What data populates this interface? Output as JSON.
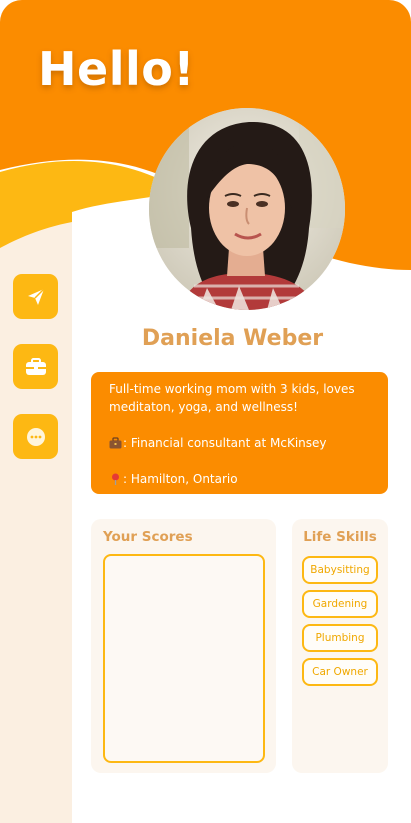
{
  "header": {
    "greeting": "Hello!"
  },
  "colors": {
    "primary": "#fb8c00",
    "accent": "#fdb813",
    "name": "#e0a055",
    "panel": "#fcf6ef",
    "strip": "#fbefe1"
  },
  "sidebar": {
    "buttons": [
      {
        "icon": "paper-plane-icon"
      },
      {
        "icon": "briefcase-icon"
      },
      {
        "icon": "chat-bubble-icon"
      }
    ]
  },
  "profile": {
    "name": "Daniela Weber",
    "bio": "Full-time working mom with 3 kids, loves meditaton, yoga, and wellness!",
    "job": ": Financial consultant at McKinsey",
    "location": ": Hamilton, Ontario"
  },
  "scores": {
    "title": "Your Scores"
  },
  "skills": {
    "title": "Life Skills",
    "items": [
      "Babysitting",
      "Gardening",
      "Plumbing",
      "Car Owner"
    ]
  }
}
